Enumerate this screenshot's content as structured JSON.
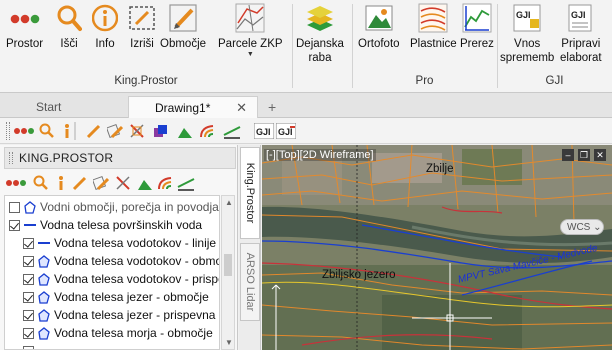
{
  "ribbon": {
    "buttons": [
      {
        "label": "Prostor",
        "icon": "traffic-dots-icon"
      },
      {
        "label": "Išči",
        "icon": "search-icon"
      },
      {
        "label": "Info",
        "icon": "info-icon"
      },
      {
        "label": "Izriši",
        "icon": "draw-select-icon"
      },
      {
        "label": "Območje",
        "icon": "pencil-area-icon"
      },
      {
        "label": "Parcele ZKP",
        "icon": "parcels-icon"
      },
      {
        "label": "Dejanska",
        "label2": "raba",
        "icon": "land-use-layers-icon"
      },
      {
        "label": "Ortofoto",
        "icon": "orthophoto-icon"
      },
      {
        "label": "Plastnice",
        "icon": "contour-lines-icon"
      },
      {
        "label": "Prerez",
        "icon": "cross-section-icon"
      },
      {
        "label": "Vnos",
        "label2": "sprememb",
        "icon": "gji-input-icon"
      },
      {
        "label": "Pripravi",
        "label2": "elaborat",
        "icon": "gji-prepare-icon"
      }
    ],
    "groups": {
      "king": "King.Prostor",
      "pro": "Pro",
      "gji": "GJI"
    }
  },
  "tabs": {
    "start": "Start",
    "drawing": "Drawing1*",
    "close": "✕",
    "add": "+"
  },
  "panel": {
    "title": "KING.PROSTOR",
    "tree": [
      {
        "label": "Vodni območji, porečja in povodja",
        "checked": false,
        "indent": false
      },
      {
        "label": "Vodna telesa površinskih voda",
        "checked": true,
        "indent": false
      },
      {
        "label": "Vodna telesa vodotokov - linije",
        "checked": true,
        "indent": true
      },
      {
        "label": "Vodna telesa vodotokov - območ",
        "checked": true,
        "indent": true
      },
      {
        "label": "Vodna telesa vodotokov - prispev",
        "checked": true,
        "indent": true
      },
      {
        "label": "Vodna telesa jezer - območje",
        "checked": true,
        "indent": true
      },
      {
        "label": "Vodna telesa jezer - prispevna po",
        "checked": true,
        "indent": true
      },
      {
        "label": "Vodna telesa morja - območje",
        "checked": true,
        "indent": true
      }
    ]
  },
  "vtabs": {
    "king": "King.Prostor",
    "arso": "ARSO Lidar"
  },
  "viewport": {
    "label": "[-][Top][2D Wireframe]",
    "wcs": "WCS ⌄",
    "places": {
      "zbilje": "Zbilje",
      "jezero": "Zbiljsko jezero"
    },
    "river": "MPVT Sava Mavčiče - Medvode"
  },
  "colors": {
    "accent_red": "#d23b2a",
    "accent_orange": "#e58a1f",
    "water_blue": "#1a3fd0",
    "contour_orange": "#e88a2a"
  }
}
